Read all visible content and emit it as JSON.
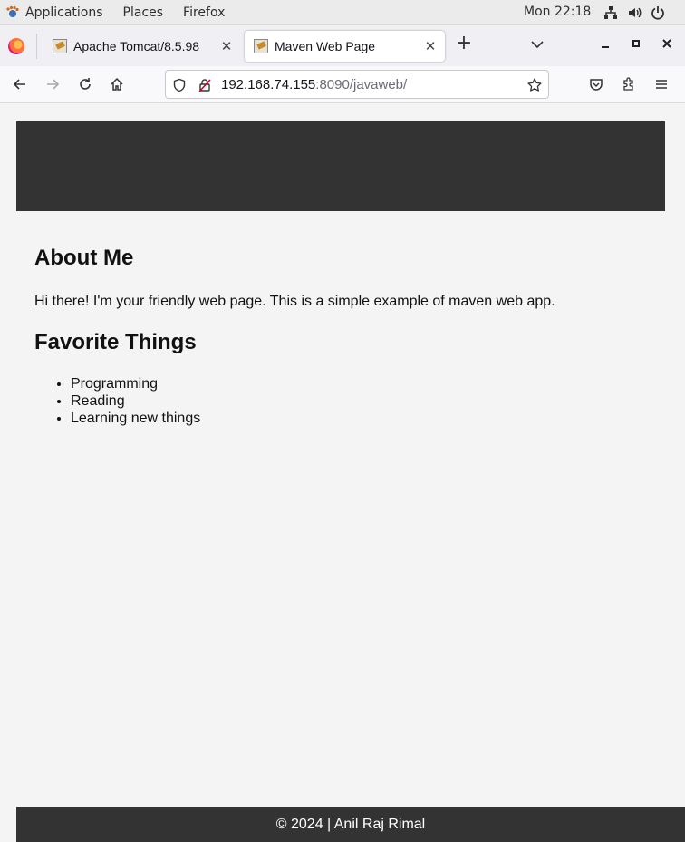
{
  "system_bar": {
    "applications_label": "Applications",
    "places_label": "Places",
    "app_label": "Firefox",
    "clock": "Mon 22:18"
  },
  "tabs": [
    {
      "title": "Apache Tomcat/8.5.98",
      "active": false
    },
    {
      "title": "Maven Web Page",
      "active": true
    }
  ],
  "urlbar": {
    "host": "192.168.74.155",
    "rest": ":8090/javaweb/"
  },
  "page": {
    "about_heading": "About Me",
    "about_text": "Hi there! I'm your friendly web page. This is a simple example of maven web app.",
    "favorites_heading": "Favorite Things",
    "favorites": [
      "Programming",
      "Reading",
      "Learning new things"
    ],
    "footer": "© 2024 | Anil Raj Rimal"
  },
  "colors": {
    "header_bg": "#333333",
    "footer_bg": "#333333",
    "page_bg": "#f4f4f4"
  }
}
